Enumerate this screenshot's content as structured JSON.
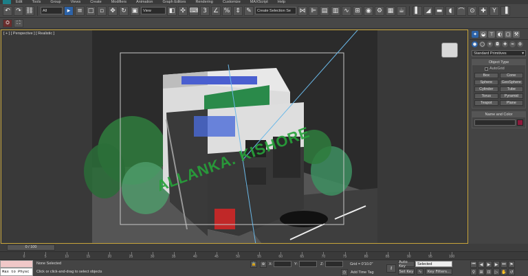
{
  "menu": [
    "Edit",
    "Tools",
    "Group",
    "Views",
    "Create",
    "Modifiers",
    "Animation",
    "Graph Editors",
    "Rendering",
    "Customize",
    "MAXScript",
    "Help"
  ],
  "toolbar": {
    "selection_filter": "All",
    "reference_coord": "View",
    "named_selection_placeholder": "Create Selection Se"
  },
  "viewport": {
    "label": "[ + ] [ Perspective ] [ Realistic ]",
    "watermark": "ALLANKA. KISHORE"
  },
  "command_panel": {
    "category": "Standard Primitives",
    "object_type_title": "Object Type",
    "autogrid_label": "AutoGrid",
    "primitives": [
      "Box",
      "Cone",
      "Sphere",
      "GeoSphere",
      "Cylinder",
      "Tube",
      "Torus",
      "Pyramid",
      "Teapot",
      "Plane"
    ],
    "name_color_title": "Name and Color",
    "object_color": "#8e1b3c"
  },
  "timeline": {
    "slider_label": "0 / 100",
    "ticks": [
      "0",
      "5",
      "10",
      "15",
      "20",
      "25",
      "30",
      "35",
      "40",
      "45",
      "50",
      "55",
      "60",
      "65",
      "70",
      "75",
      "80",
      "85",
      "90",
      "95",
      "100"
    ]
  },
  "status": {
    "maxscript_text": "Max to Physc",
    "selection_text": "None Selected",
    "prompt_text": "Click or click-and-drag to select objects",
    "x_label": "X:",
    "y_label": "Y:",
    "z_label": "Z:",
    "grid_text": "Grid = 0'10.0\"",
    "add_time_tag": "Add Time Tag",
    "auto_key": "Auto Key",
    "auto_key_target": "Selected",
    "set_key": "Set Key",
    "key_filters": "Key Filters..."
  }
}
